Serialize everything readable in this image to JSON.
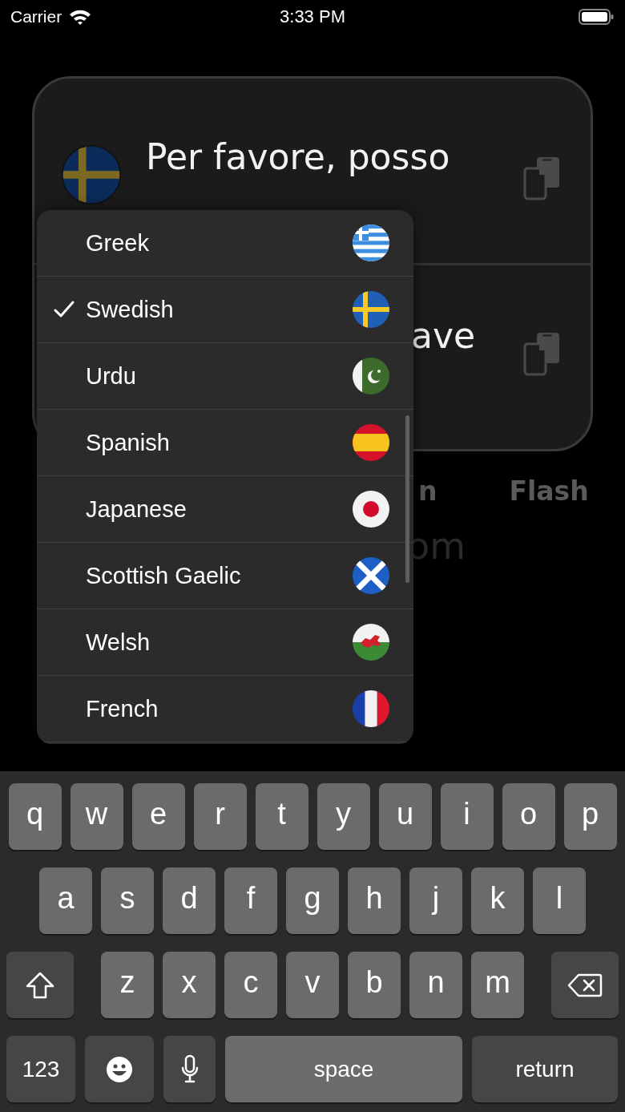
{
  "status_bar": {
    "carrier": "Carrier",
    "time": "3:33 PM"
  },
  "card": {
    "source_text": "Per favore, posso",
    "target_text": "ave"
  },
  "tabs": [
    {
      "label": "n"
    },
    {
      "label": "Flash"
    }
  ],
  "background_text": "om",
  "language_menu": {
    "items": [
      {
        "label": "Greek",
        "selected": false
      },
      {
        "label": "Swedish",
        "selected": true
      },
      {
        "label": "Urdu",
        "selected": false
      },
      {
        "label": "Spanish",
        "selected": false
      },
      {
        "label": "Japanese",
        "selected": false
      },
      {
        "label": "Scottish Gaelic",
        "selected": false
      },
      {
        "label": "Welsh",
        "selected": false
      },
      {
        "label": "French",
        "selected": false
      }
    ]
  },
  "keyboard": {
    "rows": [
      [
        "q",
        "w",
        "e",
        "r",
        "t",
        "y",
        "u",
        "i",
        "o",
        "p"
      ],
      [
        "a",
        "s",
        "d",
        "f",
        "g",
        "h",
        "j",
        "k",
        "l"
      ],
      [
        "z",
        "x",
        "c",
        "v",
        "b",
        "n",
        "m"
      ]
    ],
    "numbers_key": "123",
    "space_key": "space",
    "return_key": "return"
  }
}
